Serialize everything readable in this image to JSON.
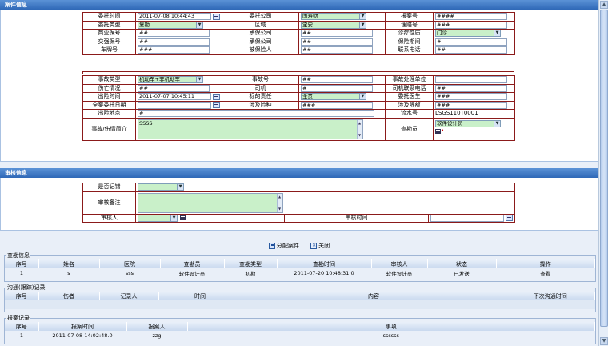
{
  "case_section": {
    "title": "案件信息",
    "rows": {
      "r1": {
        "l1": "委托时间",
        "v1": "2011-07-08 10:44:43",
        "l2": "委托公司",
        "v2": "国寿财",
        "l3": "报案号",
        "v3": "####"
      },
      "r2": {
        "l1": "委托类型",
        "v1": "复勘",
        "l2": "区域",
        "v2": "宝安",
        "l3": "理赔号",
        "v3": "###"
      },
      "r3": {
        "l1": "商业保号",
        "v1": "##",
        "l2": "承保公司",
        "v2": "##",
        "l3": "诊疗性质",
        "v3": "门诊"
      },
      "r4": {
        "l1": "交强保号",
        "v1": "##",
        "l2": "承保公司",
        "v2": "##",
        "l3": "保险期间",
        "v3": "#"
      },
      "r5": {
        "l1": "车牌号",
        "v1": "###",
        "l2": "被保险人",
        "v2": "##",
        "l3": "联系电话",
        "v3": "##"
      },
      "r6": {
        "l1": "事故类型",
        "v1": "机动车+非机动车",
        "l2": "事故号",
        "v2": "##",
        "l3": "事故处理单位",
        "v3": ""
      },
      "r7": {
        "l1": "伤亡情况",
        "v1": "##",
        "l2": "司机",
        "v2": "#",
        "l3": "司机联系电话",
        "v3": "##"
      },
      "r8": {
        "l1": "出险时间",
        "v1": "2011-07-07 10:45:11",
        "l2": "标的责任",
        "v2": "全责",
        "l3": "委托医生",
        "v3": "###"
      },
      "r9": {
        "l1": "全案委托日期",
        "v1": "",
        "l2": "涉及险种",
        "v2": "###",
        "l3": "涉及限额",
        "v3": "###"
      },
      "r10": {
        "l1": "出险地点",
        "v1": "#",
        "l3": "流水号",
        "v3": "LSGS110T0001"
      },
      "r11": {
        "l1": "事故/伤情简介",
        "v1": "SSSS",
        "l3": "查勘员",
        "v3": "软件设计员"
      }
    }
  },
  "review_section": {
    "title": "审核信息",
    "is_recorded_label": "是否记错",
    "remark_label": "审核备注",
    "reviewer_label": "审核人",
    "review_time_label": "审核时间"
  },
  "buttons": {
    "assign": "分配案件",
    "close": "关闭"
  },
  "survey_info": {
    "legend": "查勘信息",
    "headers": [
      "序号",
      "姓名",
      "医院",
      "查勘员",
      "查勘类型",
      "查勘时间",
      "审核人",
      "状态",
      "操作"
    ],
    "rows": [
      [
        "1",
        "s",
        "sss",
        "软件设计员",
        "初勘",
        "2011-07-20 10:48:31.0",
        "软件设计员",
        "已发送",
        "查看"
      ]
    ]
  },
  "communication": {
    "legend": "沟通(跟踪)记录",
    "headers": [
      "序号",
      "伤者",
      "记录人",
      "时间",
      "内容",
      "下次沟通时间"
    ]
  },
  "report_record": {
    "legend": "报案记录",
    "headers": [
      "序号",
      "报案时间",
      "报案人",
      "事项"
    ],
    "rows": [
      [
        "1",
        "2011-07-08 14:02:48.0",
        "zzg",
        "ssssss"
      ]
    ]
  }
}
